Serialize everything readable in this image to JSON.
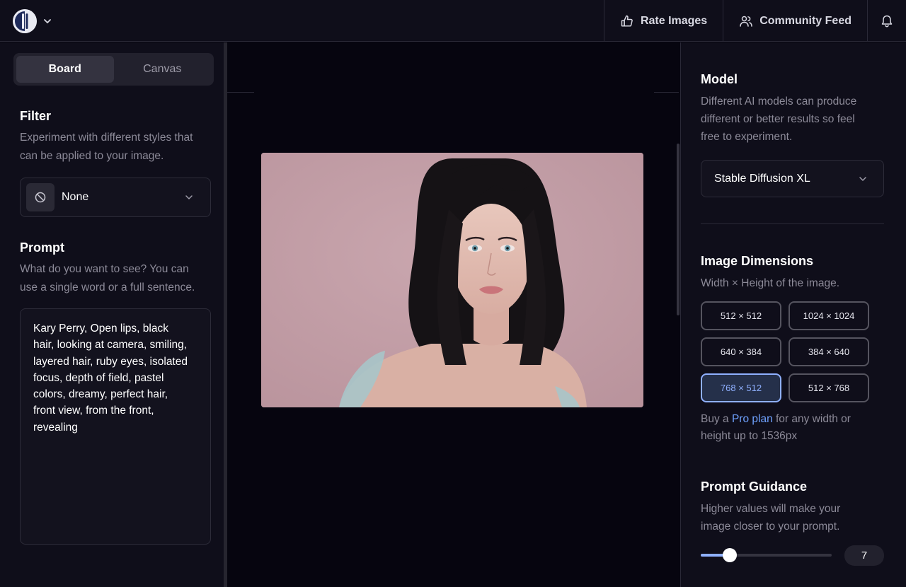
{
  "topbar": {
    "rate_images": "Rate Images",
    "community_feed": "Community Feed"
  },
  "left": {
    "tabs": [
      {
        "label": "Board",
        "active": true
      },
      {
        "label": "Canvas",
        "active": false
      }
    ],
    "filter": {
      "title": "Filter",
      "desc_lines": [
        "Experiment with different styles that",
        "can be applied to your image."
      ],
      "value": "None"
    },
    "prompt": {
      "title": "Prompt",
      "desc_lines": [
        "What do you want to see? You can",
        "use a single word or a full sentence."
      ],
      "text_lines": [
        "Kary Perry, Open lips, black",
        "hair, looking at camera, smiling,",
        "layered hair, ruby eyes, isolated",
        "focus, depth of field, pastel",
        "colors, dreamy, perfect hair,",
        "front view, from the front,",
        "revealing"
      ]
    }
  },
  "right": {
    "model": {
      "title": "Model",
      "desc_lines": [
        "Different AI models can produce",
        "different or better results so feel",
        "free to experiment."
      ],
      "value": "Stable Diffusion XL"
    },
    "dimensions": {
      "title": "Image Dimensions",
      "desc": "Width × Height of the image.",
      "options": [
        "512 × 512",
        "1024 × 1024",
        "640 × 384",
        "384 × 640",
        "768 × 512",
        "512 × 768"
      ],
      "selected": "768 × 512",
      "pro_prefix": "Buy a ",
      "pro_link": "Pro plan",
      "pro_suffix_line1": " for any width or",
      "pro_line2": "height up to 1536px"
    },
    "guidance": {
      "title": "Prompt Guidance",
      "desc_lines": [
        "Higher values will make your",
        "image closer to your prompt."
      ],
      "value": "7",
      "fraction": 0.22
    }
  },
  "colors": {
    "accent": "#8fb0ff",
    "link": "#6fa2ff",
    "panel": "#0f0e1a",
    "canvas": "#06050f"
  },
  "icons": {
    "logo": "app-logo-icon",
    "thumbs_up": "thumbs-up-icon",
    "users": "users-icon",
    "bell": "bell-icon",
    "ban": "ban-icon",
    "chevron": "chevron-down-icon"
  }
}
